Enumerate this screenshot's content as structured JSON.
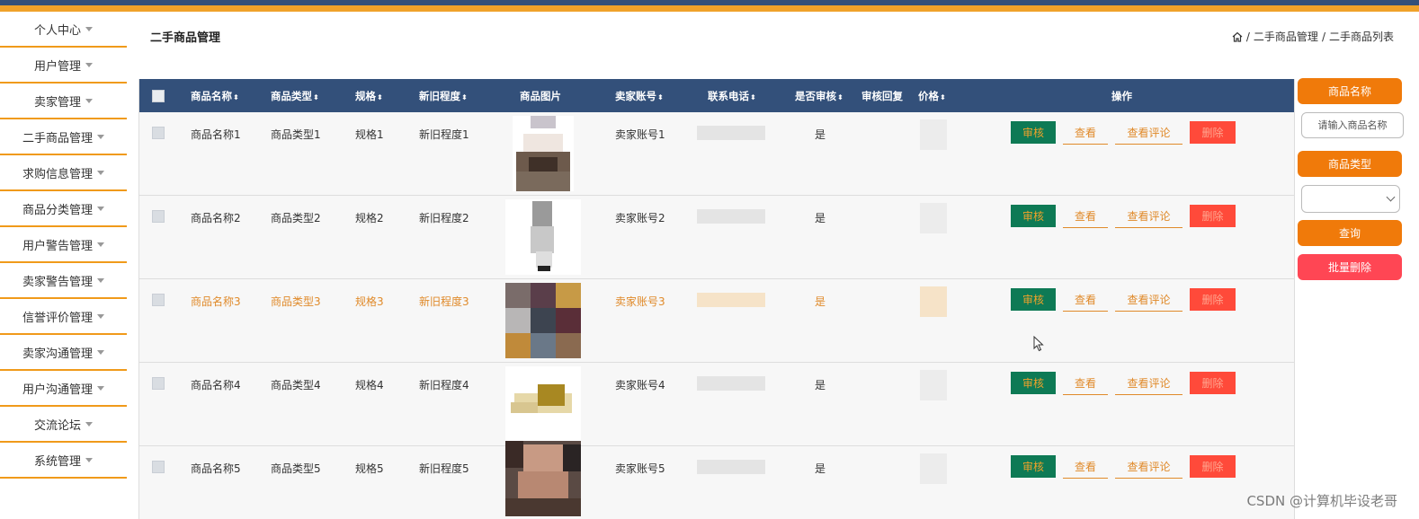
{
  "sidebar": {
    "items": [
      {
        "label": "个人中心"
      },
      {
        "label": "用户管理"
      },
      {
        "label": "卖家管理"
      },
      {
        "label": "二手商品管理"
      },
      {
        "label": "求购信息管理"
      },
      {
        "label": "商品分类管理"
      },
      {
        "label": "用户警告管理"
      },
      {
        "label": "卖家警告管理"
      },
      {
        "label": "信誉评价管理"
      },
      {
        "label": "卖家沟通管理"
      },
      {
        "label": "用户沟通管理"
      },
      {
        "label": "交流论坛"
      },
      {
        "label": "系统管理"
      }
    ]
  },
  "header": {
    "title": "二手商品管理",
    "breadcrumb": [
      "二手商品管理",
      "二手商品列表"
    ],
    "separator": "/"
  },
  "table": {
    "columns": [
      "商品名称",
      "商品类型",
      "规格",
      "新旧程度",
      "商品图片",
      "卖家账号",
      "联系电话",
      "是否审核",
      "审核回复",
      "价格",
      "操作"
    ],
    "sort_icon": "⬍",
    "rows": [
      {
        "name": "商品名称1",
        "type": "商品类型1",
        "spec": "规格1",
        "condition": "新旧程度1",
        "seller": "卖家账号1",
        "audited": "是"
      },
      {
        "name": "商品名称2",
        "type": "商品类型2",
        "spec": "规格2",
        "condition": "新旧程度2",
        "seller": "卖家账号2",
        "audited": "是"
      },
      {
        "name": "商品名称3",
        "type": "商品类型3",
        "spec": "规格3",
        "condition": "新旧程度3",
        "seller": "卖家账号3",
        "audited": "是"
      },
      {
        "name": "商品名称4",
        "type": "商品类型4",
        "spec": "规格4",
        "condition": "新旧程度4",
        "seller": "卖家账号4",
        "audited": "是"
      },
      {
        "name": "商品名称5",
        "type": "商品类型5",
        "spec": "规格5",
        "condition": "新旧程度5",
        "seller": "卖家账号5",
        "audited": "是"
      }
    ],
    "actions": {
      "audit": "审核",
      "view": "查看",
      "comments": "查看评论",
      "delete": "删除"
    }
  },
  "search_panel": {
    "name_button": "商品名称",
    "name_placeholder": "请输入商品名称",
    "type_button": "商品类型",
    "query_button": "查询",
    "batch_delete_button": "批量删除"
  },
  "watermark": "CSDN @计算机毕设老哥",
  "colors": {
    "header": "#33507a",
    "accent": "#f0a22a",
    "audit_bg": "#0e7a55",
    "delete_bg": "#ff4a3a"
  }
}
